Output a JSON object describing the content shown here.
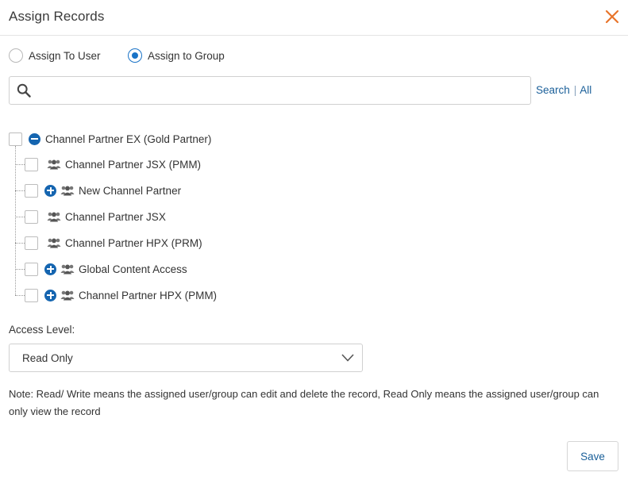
{
  "dialog": {
    "title": "Assign Records"
  },
  "assign_mode": {
    "options": [
      {
        "label": "Assign To User",
        "selected": false
      },
      {
        "label": "Assign to Group",
        "selected": true
      }
    ]
  },
  "search": {
    "value": "",
    "placeholder": "",
    "search_link": "Search",
    "separator": "|",
    "all_link": "All"
  },
  "tree": {
    "root": {
      "label": "Channel Partner EX (Gold Partner)",
      "expanded": true,
      "checked": false
    },
    "children": [
      {
        "label": "Channel Partner JSX (PMM)",
        "expandable": false,
        "checked": false
      },
      {
        "label": "New Channel Partner",
        "expandable": true,
        "checked": false
      },
      {
        "label": "Channel Partner JSX",
        "expandable": false,
        "checked": false
      },
      {
        "label": "Channel Partner HPX (PRM)",
        "expandable": false,
        "checked": false
      },
      {
        "label": "Global Content Access",
        "expandable": true,
        "checked": false
      },
      {
        "label": "Channel Partner HPX (PMM)",
        "expandable": true,
        "checked": false
      }
    ]
  },
  "access": {
    "label": "Access Level:",
    "selected": "Read Only"
  },
  "note": "Note: Read/ Write means the assigned user/group can edit and delete the record, Read Only means the assigned user/group can only view the record",
  "save_label": "Save",
  "colors": {
    "accent": "#1a73c7",
    "close": "#e8742a",
    "link": "#1a5f99",
    "toggle": "#1565b0"
  },
  "icons": {
    "close": "close-icon",
    "search": "search-icon",
    "group": "user-group-icon",
    "expand": "plus-circle-icon",
    "collapse": "minus-circle-icon",
    "dropdown": "chevron-down-icon"
  }
}
